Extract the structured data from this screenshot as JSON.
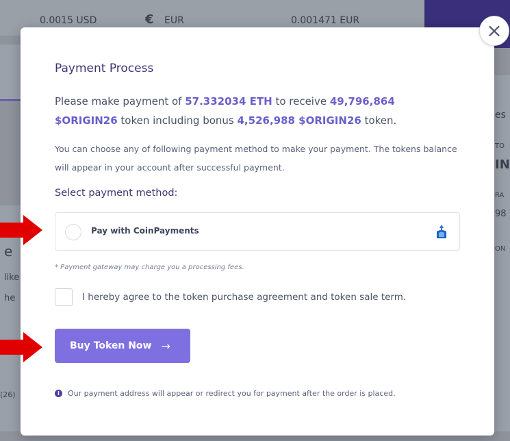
{
  "background": {
    "rate_usd": "0.0015 USD",
    "eur_symbol": "€",
    "eur_code": "EUR",
    "rate_eur": "0.001471 EUR",
    "right_partial": [
      "es",
      "TO",
      "IN",
      "RA",
      "98",
      "ON"
    ],
    "left_partial": [
      "e",
      "like",
      "he",
      "(26)"
    ]
  },
  "modal": {
    "title": "Payment Process",
    "lead": {
      "p1": "Please make payment of ",
      "amount": "57.332034 ETH",
      "p2": " to receive ",
      "tokens": "49,796,864 $ORIGIN26",
      "p3": " token including bonus ",
      "bonus": "4,526,988 $ORIGIN26",
      "p4": " token."
    },
    "description": "You can choose any of following payment method to make your payment. The tokens balance will appear in your account after successful payment.",
    "select_label": "Select payment method:",
    "method_label": "Pay with CoinPayments",
    "gateway_note": "* Payment gateway may charge you a processing fees.",
    "agreement": "I hereby agree to the token purchase agreement and token sale term.",
    "buy_button": "Buy Token Now",
    "buy_arrow": "→",
    "footnote": "Our payment address will appear or redirect you for payment after the order is placed.",
    "close_glyph": "×"
  },
  "colors": {
    "accent": "#7e70e0",
    "highlight": "#6a5fc9",
    "title": "#3c3573",
    "arrow": "#e10000"
  }
}
